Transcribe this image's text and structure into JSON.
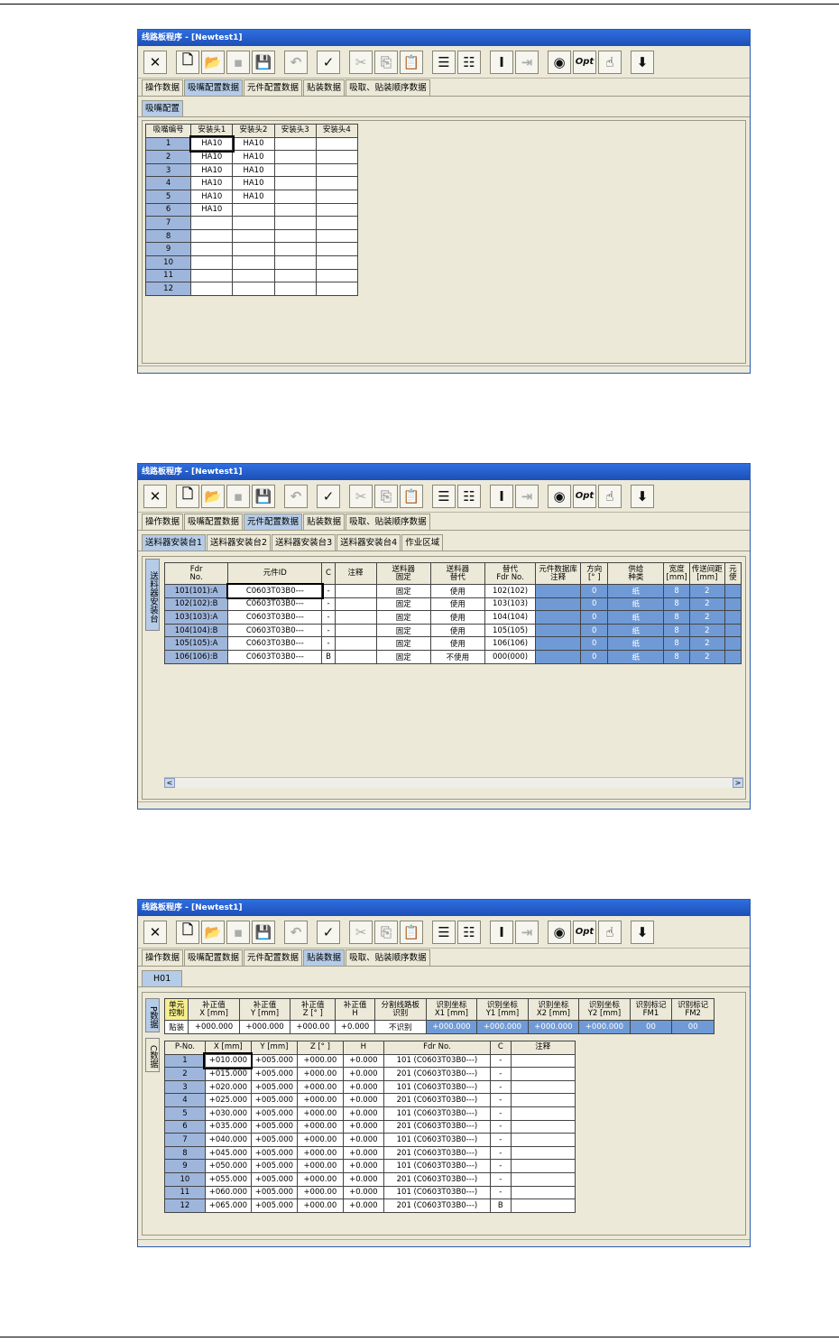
{
  "window_title": "线路板程序 - [Newtest1]",
  "toolbar_icons": [
    "close-x-icon",
    "new-file-icon",
    "open-folder-icon",
    "save-disabled-icon",
    "save-all-icon",
    "undo-icon",
    "check-icon",
    "cut-icon",
    "copy-icon",
    "paste-icon",
    "insert-row-icon",
    "add-row-icon",
    "cursor-icon",
    "goto-icon",
    "database-icon",
    "opt-icon",
    "hand-icon",
    "download-arrow-icon"
  ],
  "toolbar_opt_label": "Opt",
  "main_tabs": [
    "操作数据",
    "吸嘴配置数据",
    "元件配置数据",
    "贴装数据",
    "吸取、贴装顺序数据"
  ],
  "screen1": {
    "subtab": "吸嘴配置",
    "headers": [
      "吸嘴编号",
      "安装头1",
      "安装头2",
      "安装头3",
      "安装头4"
    ],
    "rows": [
      [
        "1",
        "HA10",
        "HA10",
        "",
        ""
      ],
      [
        "2",
        "HA10",
        "HA10",
        "",
        ""
      ],
      [
        "3",
        "HA10",
        "HA10",
        "",
        ""
      ],
      [
        "4",
        "HA10",
        "HA10",
        "",
        ""
      ],
      [
        "5",
        "HA10",
        "HA10",
        "",
        ""
      ],
      [
        "6",
        "HA10",
        "",
        "",
        ""
      ],
      [
        "7",
        "",
        "",
        "",
        ""
      ],
      [
        "8",
        "",
        "",
        "",
        ""
      ],
      [
        "9",
        "",
        "",
        "",
        ""
      ],
      [
        "10",
        "",
        "",
        "",
        ""
      ],
      [
        "11",
        "",
        "",
        "",
        ""
      ],
      [
        "12",
        "",
        "",
        "",
        ""
      ]
    ]
  },
  "screen2": {
    "subtabs": [
      "送料器安装台1",
      "送料器安装台2",
      "送料器安装台3",
      "送料器安装台4",
      "作业区域"
    ],
    "vtab": "送料器安装台",
    "headers": [
      "Fdr\nNo.",
      "元件ID",
      "C",
      "注释",
      "送料器\n固定",
      "送料器\n替代",
      "替代\nFdr No.",
      "元件数据库\n注释",
      "方向\n[° ]",
      "供给\n种类",
      "宽度\n[mm]",
      "传送间距\n[mm]",
      "元\n使"
    ],
    "rows": [
      [
        "101(101):A",
        "C0603T03B0---",
        "-",
        "",
        "固定",
        "使用",
        "102(102)",
        "",
        "0",
        "纸",
        "8",
        "2",
        ""
      ],
      [
        "102(102):B",
        "C0603T03B0---",
        "-",
        "",
        "固定",
        "使用",
        "103(103)",
        "",
        "0",
        "纸",
        "8",
        "2",
        ""
      ],
      [
        "103(103):A",
        "C0603T03B0---",
        "-",
        "",
        "固定",
        "使用",
        "104(104)",
        "",
        "0",
        "纸",
        "8",
        "2",
        ""
      ],
      [
        "104(104):B",
        "C0603T03B0---",
        "-",
        "",
        "固定",
        "使用",
        "105(105)",
        "",
        "0",
        "纸",
        "8",
        "2",
        ""
      ],
      [
        "105(105):A",
        "C0603T03B0---",
        "-",
        "",
        "固定",
        "使用",
        "106(106)",
        "",
        "0",
        "纸",
        "8",
        "2",
        ""
      ],
      [
        "106(106):B",
        "C0603T03B0---",
        "B",
        "",
        "固定",
        "不使用",
        "000(000)",
        "",
        "0",
        "纸",
        "8",
        "2",
        ""
      ]
    ],
    "scroll_left": "<",
    "scroll_right": ">"
  },
  "screen3": {
    "subtab": "H01",
    "vtab_p": "P数据",
    "vtab_c": "C数据",
    "p_headers": [
      "单元\n控制",
      "补正值\nX [mm]",
      "补正值\nY [mm]",
      "补正值\nZ [° ]",
      "补正值\nH",
      "分割线路板\n识别",
      "识别坐标\nX1 [mm]",
      "识别坐标\nY1 [mm]",
      "识别坐标\nX2 [mm]",
      "识别坐标\nY2 [mm]",
      "识别标记\nFM1",
      "识别标记\nFM2"
    ],
    "p_row": [
      "贴装",
      "+000.000",
      "+000.000",
      "+000.00",
      "+0.000",
      "不识别",
      "+000.000",
      "+000.000",
      "+000.000",
      "+000.000",
      "00",
      "00"
    ],
    "c_headers": [
      "P-No.",
      "X [mm]",
      "Y [mm]",
      "Z [° ]",
      "H",
      "Fdr No.",
      "C",
      "注释"
    ],
    "c_rows": [
      [
        "1",
        "+010.000",
        "+005.000",
        "+000.00",
        "+0.000",
        "101 (C0603T03B0---)",
        "-",
        ""
      ],
      [
        "2",
        "+015.000",
        "+005.000",
        "+000.00",
        "+0.000",
        "201 (C0603T03B0---)",
        "-",
        ""
      ],
      [
        "3",
        "+020.000",
        "+005.000",
        "+000.00",
        "+0.000",
        "101 (C0603T03B0---)",
        "-",
        ""
      ],
      [
        "4",
        "+025.000",
        "+005.000",
        "+000.00",
        "+0.000",
        "201 (C0603T03B0---)",
        "-",
        ""
      ],
      [
        "5",
        "+030.000",
        "+005.000",
        "+000.00",
        "+0.000",
        "101 (C0603T03B0---)",
        "-",
        ""
      ],
      [
        "6",
        "+035.000",
        "+005.000",
        "+000.00",
        "+0.000",
        "201 (C0603T03B0---)",
        "-",
        ""
      ],
      [
        "7",
        "+040.000",
        "+005.000",
        "+000.00",
        "+0.000",
        "101 (C0603T03B0---)",
        "-",
        ""
      ],
      [
        "8",
        "+045.000",
        "+005.000",
        "+000.00",
        "+0.000",
        "201 (C0603T03B0---)",
        "-",
        ""
      ],
      [
        "9",
        "+050.000",
        "+005.000",
        "+000.00",
        "+0.000",
        "101 (C0603T03B0---)",
        "-",
        ""
      ],
      [
        "10",
        "+055.000",
        "+005.000",
        "+000.00",
        "+0.000",
        "201 (C0603T03B0---)",
        "-",
        ""
      ],
      [
        "11",
        "+060.000",
        "+005.000",
        "+000.00",
        "+0.000",
        "101 (C0603T03B0---)",
        "-",
        ""
      ],
      [
        "12",
        "+065.000",
        "+005.000",
        "+000.00",
        "+0.000",
        "201 (C0603T03B0---)",
        "B",
        ""
      ]
    ]
  },
  "colors": {
    "title_bar": "#1d4fb6",
    "active_tab": "#b5cce8",
    "row_number": "#9fb6dc",
    "blue_cell": "#6f9ad6",
    "yellow_header": "#f7ef8f"
  }
}
